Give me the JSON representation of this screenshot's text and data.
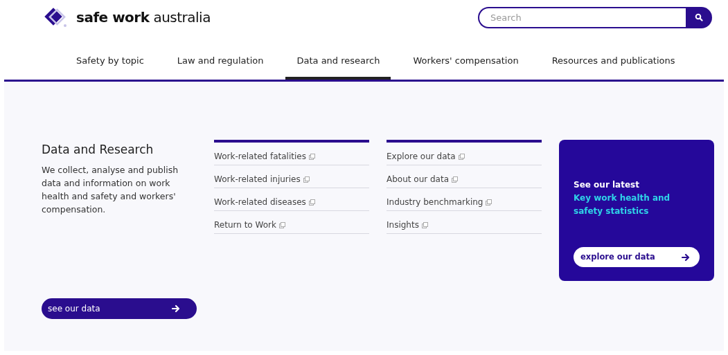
{
  "logo": {
    "text_bold": "safe work",
    "text_light": "australia"
  },
  "search": {
    "placeholder": "Search"
  },
  "nav": [
    {
      "label": "Safety by topic",
      "selected": false
    },
    {
      "label": "Law and regulation",
      "selected": false
    },
    {
      "label": "Data and research",
      "selected": true
    },
    {
      "label": "Workers' compensation",
      "selected": false
    },
    {
      "label": "Resources and publications",
      "selected": false
    }
  ],
  "intro": {
    "title": "Data and Research",
    "text": "We collect, analyse and publish data and information on work health and safety and workers' compensation.",
    "button": "see our data"
  },
  "link_columns": [
    [
      "Work-related fatalities",
      "Work-related injuries",
      "Work-related diseases",
      "Return to Work"
    ],
    [
      "Explore our data",
      "About our data",
      "Industry benchmarking",
      "Insights"
    ]
  ],
  "promo": {
    "lead": "See our latest",
    "highlight": "Key work health and safety statistics",
    "button": "explore our data"
  }
}
